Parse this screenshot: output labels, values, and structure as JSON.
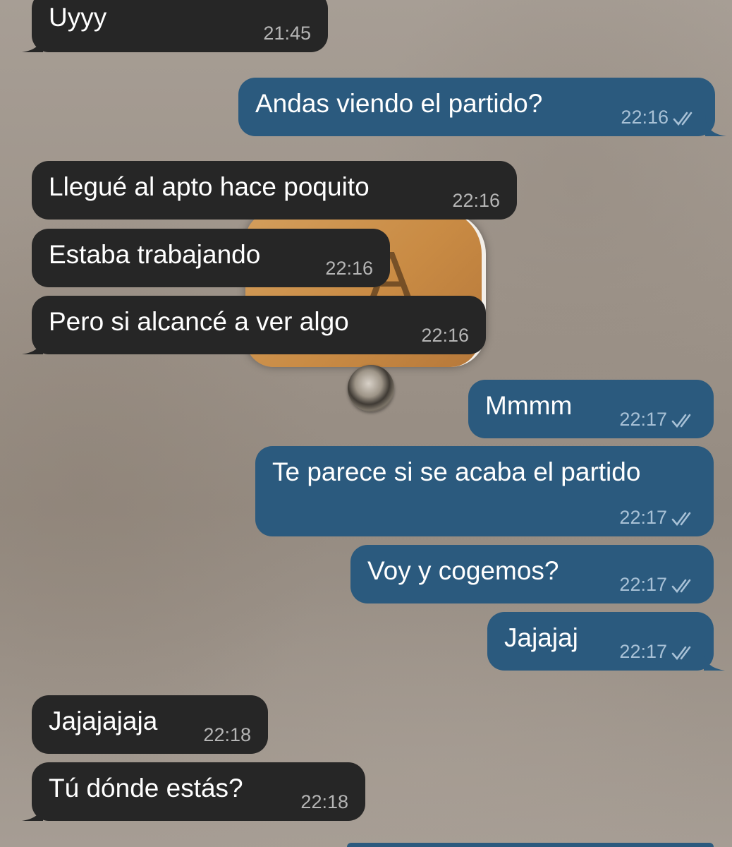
{
  "chat": {
    "messages": [
      {
        "direction": "in",
        "text": "Uyyy",
        "time": "21:45"
      },
      {
        "direction": "out",
        "text": "Andas viendo el partido?",
        "time": "22:16",
        "status": "read"
      },
      {
        "direction": "in",
        "text": "Llegué al apto hace poquito",
        "time": "22:16"
      },
      {
        "direction": "in",
        "text": "Estaba trabajando",
        "time": "22:16"
      },
      {
        "direction": "in",
        "text": "Pero si alcancé a ver algo",
        "time": "22:16"
      },
      {
        "direction": "out",
        "text": "Mmmm",
        "time": "22:17",
        "status": "read"
      },
      {
        "direction": "out",
        "text": "Te parece si se acaba el partido",
        "time": "22:17",
        "status": "read"
      },
      {
        "direction": "out",
        "text": "Voy y cogemos?",
        "time": "22:17",
        "status": "read"
      },
      {
        "direction": "out",
        "text": "Jajajaj",
        "time": "22:17",
        "status": "read"
      },
      {
        "direction": "in",
        "text": "Jajajajaja",
        "time": "22:18"
      },
      {
        "direction": "in",
        "text": "Tú dónde estás?",
        "time": "22:18"
      }
    ]
  },
  "wallpaper": {
    "letter": "A"
  },
  "colors": {
    "incoming_bubble": "#262626",
    "outgoing_bubble": "#2b5a7e",
    "incoming_time": "#b5b5b5",
    "outgoing_time": "#a8c1d6"
  },
  "icons": {
    "read_receipt": "double-check-icon",
    "peephole": "peephole-icon"
  }
}
